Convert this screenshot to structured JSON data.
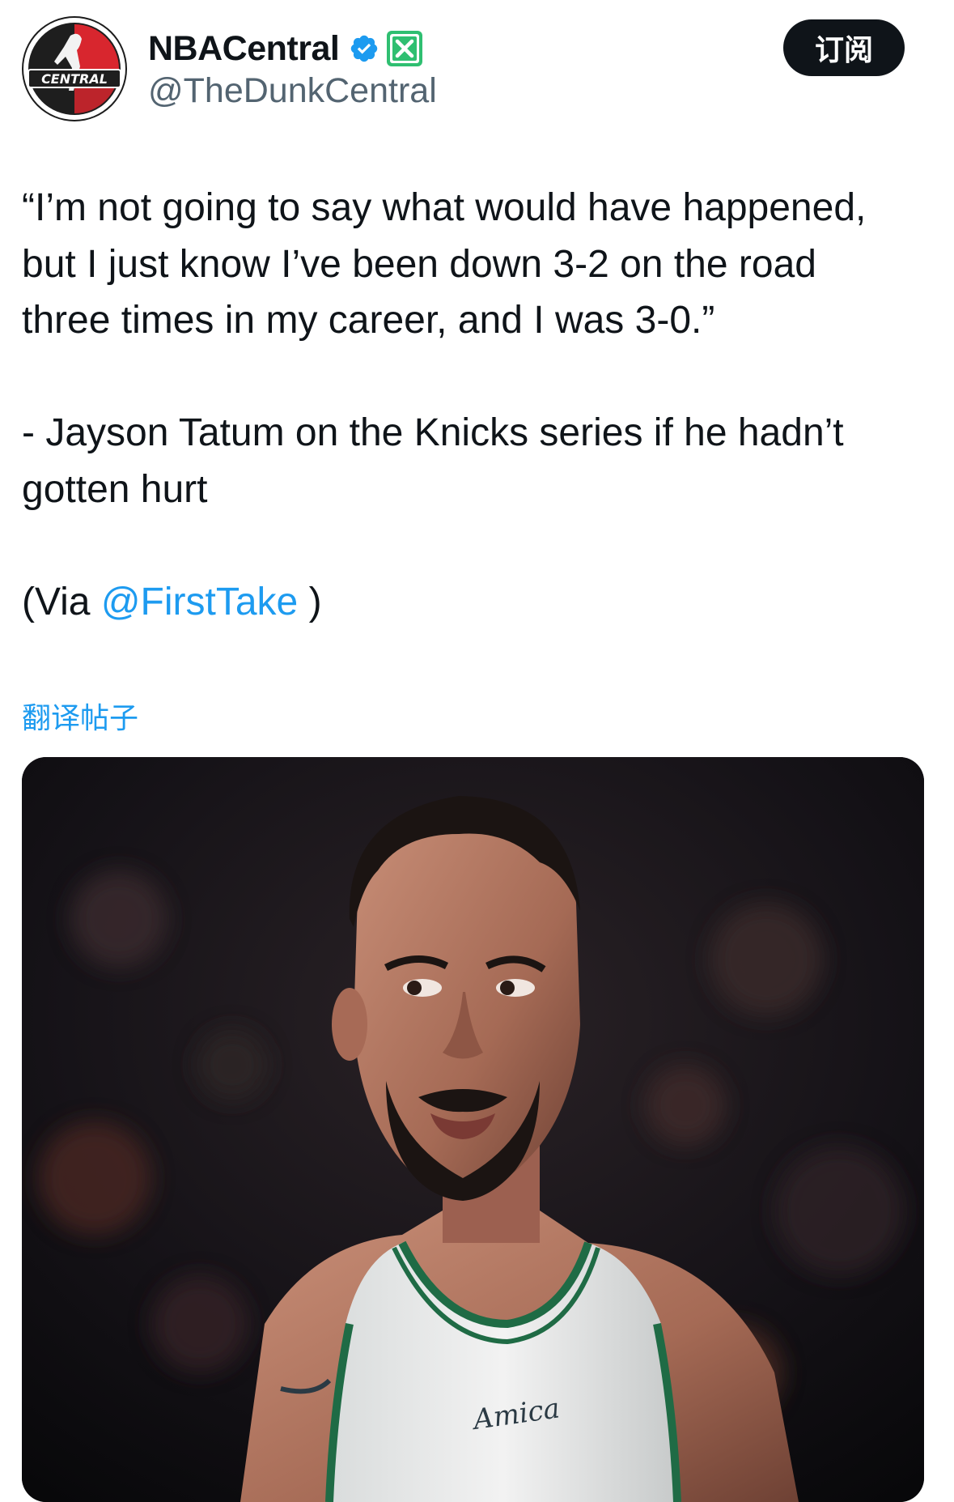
{
  "account": {
    "display_name": "NBACentral",
    "handle": "@TheDunkCentral",
    "avatar_icon": "nba-central-logo-icon",
    "avatar_text": "CENTRAL",
    "verified_icon": "verified-badge-icon",
    "affiliate_icon": "x-affiliate-badge-icon"
  },
  "actions": {
    "subscribe_label": "订阅"
  },
  "post": {
    "quote_lines": [
      "“I’m not going to say what would have happened,",
      "but I just know I’ve been down 3-2 on the road",
      "three times in my career, and I was 3-0.”"
    ],
    "attribution_lines": [
      "- Jayson Tatum on the Knicks series if he hadn’t",
      "gotten hurt"
    ],
    "via_prefix": "(Via ",
    "via_mention": "@FirstTake",
    "via_suffix": " )",
    "translate_label": "翻译帖子"
  },
  "media": {
    "jersey_text": "Amica"
  },
  "colors": {
    "accent": "#1d9bf0",
    "text": "#0f1419",
    "muted": "#536471",
    "affiliate_green": "#2fbf71"
  }
}
